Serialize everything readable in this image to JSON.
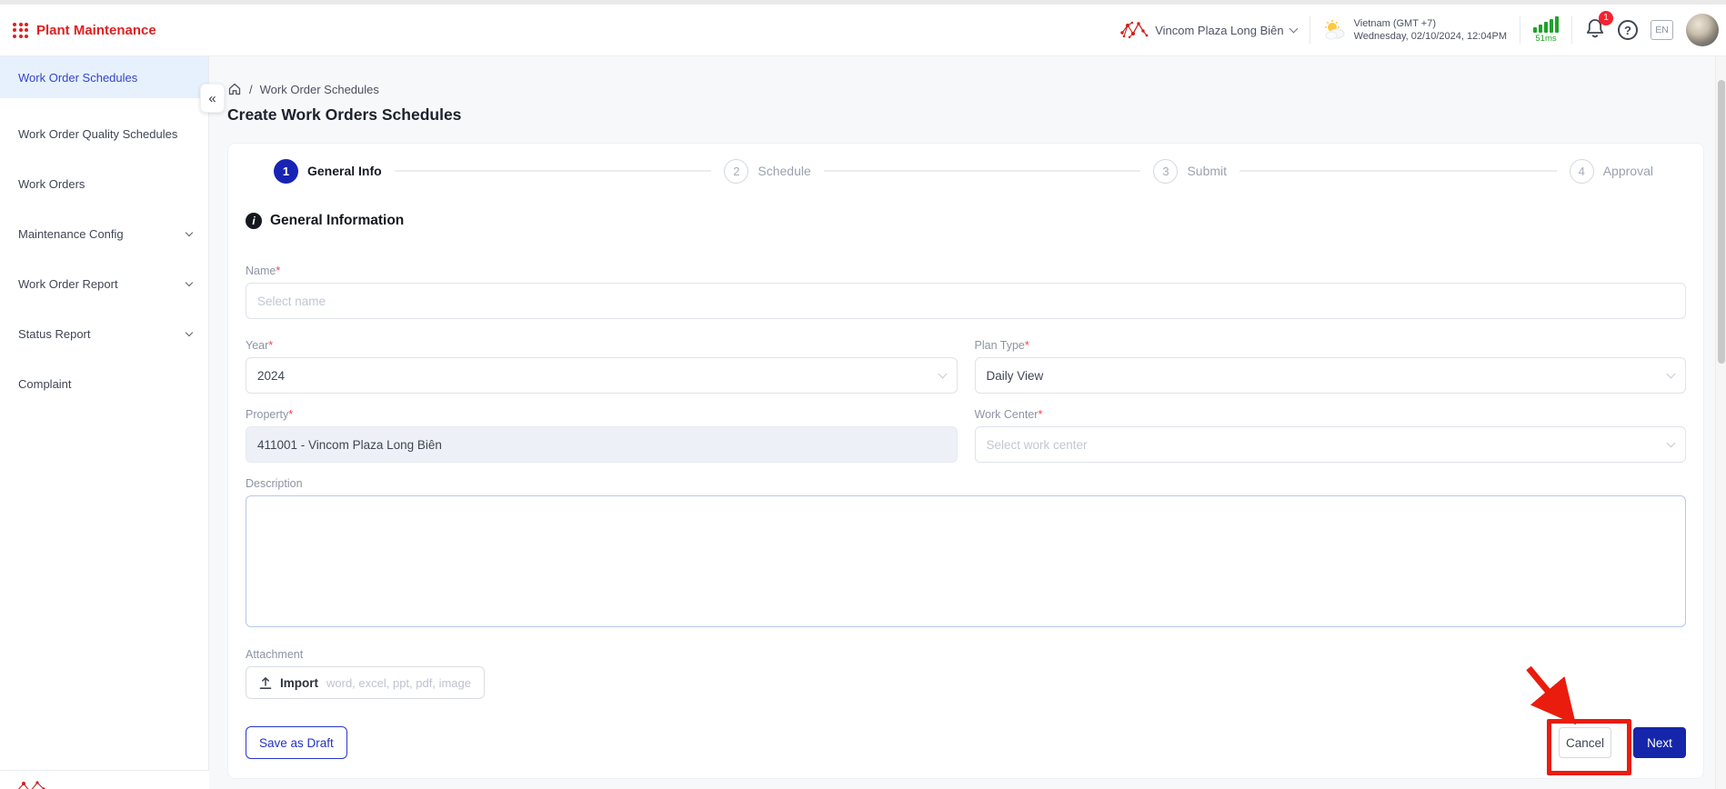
{
  "header": {
    "app_title": "Plant Maintenance",
    "property_selector": "Vincom Plaza Long Biên",
    "timezone": "Vietnam (GMT +7)",
    "datetime": "Wednesday, 02/10/2024, 12:04PM",
    "latency": "51ms",
    "notification_count": "1",
    "language": "EN"
  },
  "sidebar": {
    "collapse_label": "«",
    "items": [
      {
        "label": "Work Order Schedules",
        "active": true
      },
      {
        "label": "Work Order Quality Schedules"
      },
      {
        "label": "Work Orders"
      },
      {
        "label": "Maintenance Config",
        "expandable": true
      },
      {
        "label": "Work Order Report",
        "expandable": true
      },
      {
        "label": "Status Report",
        "expandable": true
      },
      {
        "label": "Complaint"
      }
    ]
  },
  "breadcrumb": {
    "separator": "/",
    "current": "Work Order Schedules"
  },
  "page": {
    "title": "Create Work Orders Schedules"
  },
  "stepper": [
    {
      "number": "1",
      "label": "General Info",
      "active": true
    },
    {
      "number": "2",
      "label": "Schedule",
      "active": false
    },
    {
      "number": "3",
      "label": "Submit",
      "active": false
    },
    {
      "number": "4",
      "label": "Approval",
      "active": false
    }
  ],
  "form": {
    "section_title": "General Information",
    "info_glyph": "i",
    "required_mark": "*",
    "fields": {
      "name": {
        "label": "Name",
        "placeholder": "Select name"
      },
      "year": {
        "label": "Year",
        "value": "2024"
      },
      "plan_type": {
        "label": "Plan Type",
        "value": "Daily View"
      },
      "property": {
        "label": "Property",
        "value": "411001 - Vincom Plaza Long Biên",
        "disabled": true
      },
      "work_center": {
        "label": "Work Center",
        "placeholder": "Select work center"
      },
      "description": {
        "label": "Description",
        "value": ""
      },
      "attachment": {
        "label": "Attachment",
        "import_label": "Import",
        "hint": "word, excel, ppt, pdf, image"
      }
    },
    "buttons": {
      "save_draft": "Save as Draft",
      "cancel": "Cancel",
      "next": "Next"
    }
  },
  "colors": {
    "brand_red": "#e02020",
    "primary_blue": "#1626ab",
    "active_step_blue": "#1824b3",
    "sidebar_active_bg": "#e7f1fd",
    "success_green": "#1fa32a",
    "annotation_red": "#ea1c0d",
    "notification_red": "#f5222d"
  }
}
